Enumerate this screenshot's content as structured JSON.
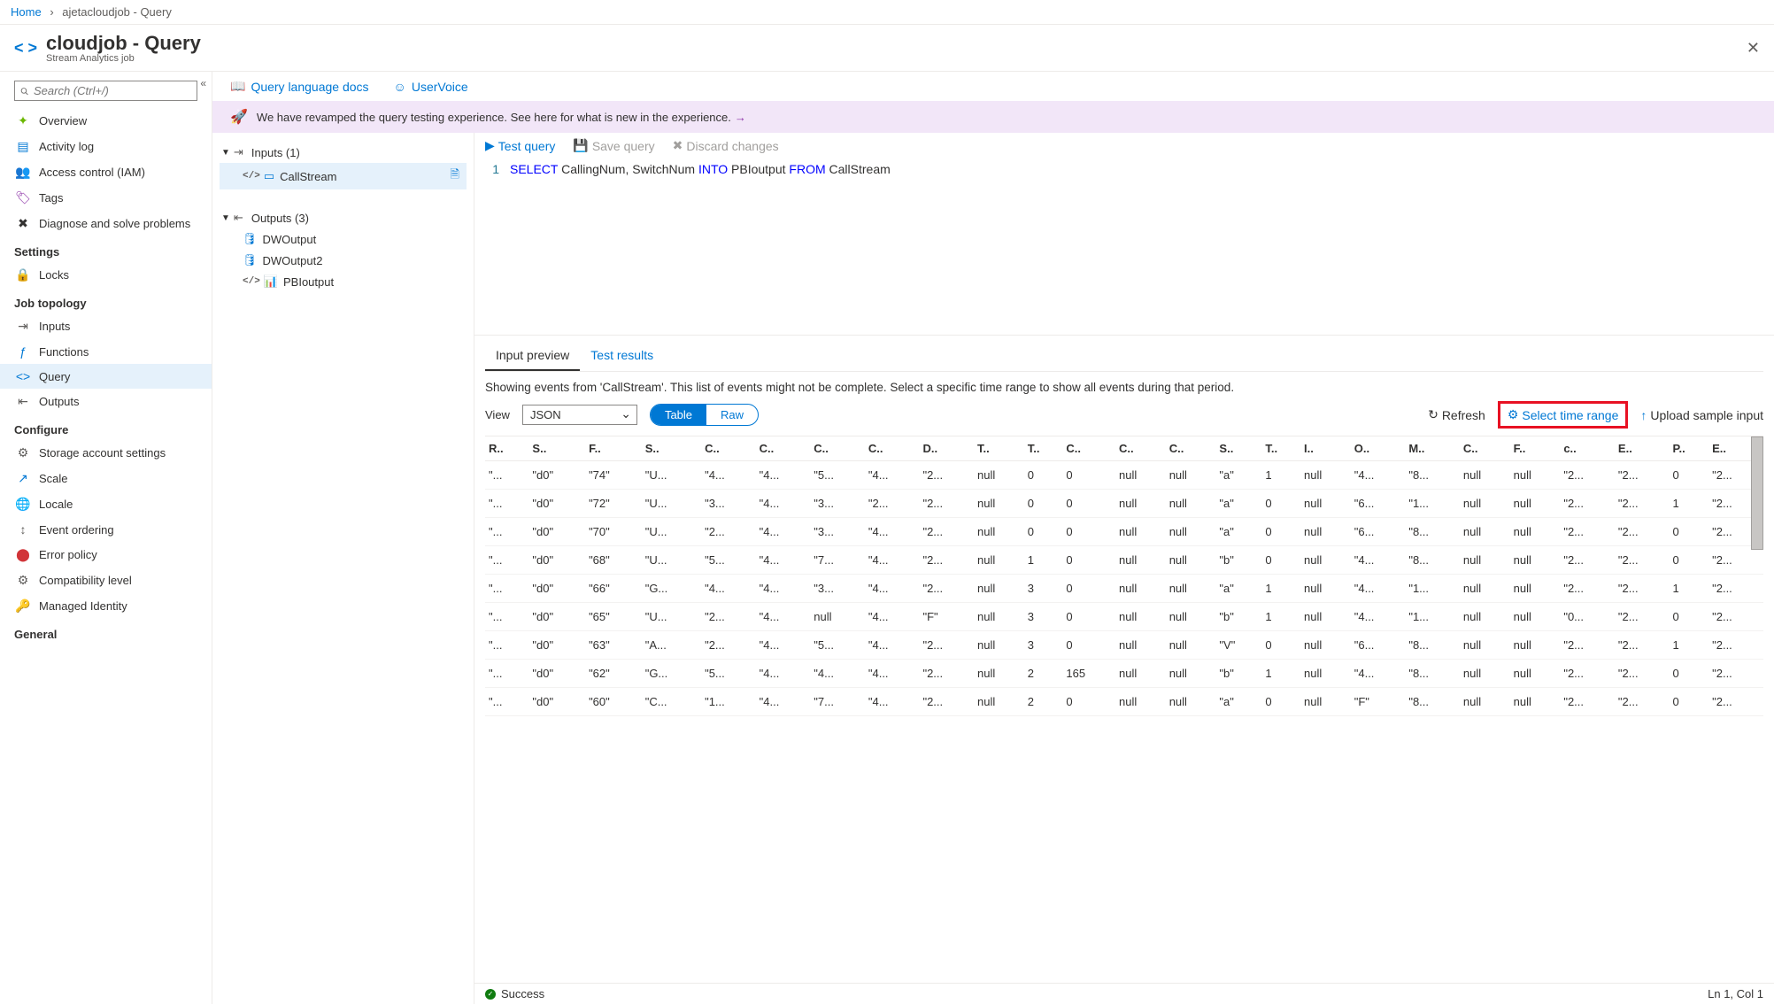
{
  "breadcrumb": {
    "home": "Home",
    "current": "ajetacloudjob - Query"
  },
  "header": {
    "title": "cloudjob - Query",
    "subtitle": "Stream Analytics job"
  },
  "sidebar": {
    "search_placeholder": "Search (Ctrl+/)",
    "groups": {
      "top": [
        {
          "label": "Overview"
        },
        {
          "label": "Activity log"
        },
        {
          "label": "Access control (IAM)"
        },
        {
          "label": "Tags"
        },
        {
          "label": "Diagnose and solve problems"
        }
      ],
      "settings_head": "Settings",
      "settings": [
        {
          "label": "Locks"
        }
      ],
      "topology_head": "Job topology",
      "topology": [
        {
          "label": "Inputs"
        },
        {
          "label": "Functions"
        },
        {
          "label": "Query"
        },
        {
          "label": "Outputs"
        }
      ],
      "configure_head": "Configure",
      "configure": [
        {
          "label": "Storage account settings"
        },
        {
          "label": "Scale"
        },
        {
          "label": "Locale"
        },
        {
          "label": "Event ordering"
        },
        {
          "label": "Error policy"
        },
        {
          "label": "Compatibility level"
        },
        {
          "label": "Managed Identity"
        }
      ],
      "general_head": "General"
    }
  },
  "toolbar": {
    "query_docs": "Query language docs",
    "uservoice": "UserVoice"
  },
  "banner": {
    "text": "We have revamped the query testing experience. See here for what is new in the experience."
  },
  "io": {
    "inputs_label": "Inputs (1)",
    "inputs": [
      {
        "label": "CallStream"
      }
    ],
    "outputs_label": "Outputs (3)",
    "outputs": [
      {
        "label": "DWOutput"
      },
      {
        "label": "DWOutput2"
      },
      {
        "label": "PBIoutput"
      }
    ]
  },
  "editor": {
    "test": "Test query",
    "save": "Save query",
    "discard": "Discard changes",
    "line_no": "1",
    "tokens": {
      "select": "SELECT",
      "cols": "CallingNum, SwitchNum",
      "into": "INTO",
      "target": "PBIoutput",
      "from": "FROM",
      "source": "CallStream"
    }
  },
  "results": {
    "tab_preview": "Input preview",
    "tab_results": "Test results",
    "description": "Showing events from 'CallStream'. This list of events might not be complete. Select a specific time range to show all events during that period.",
    "view_label": "View",
    "view_value": "JSON",
    "toggle_table": "Table",
    "toggle_raw": "Raw",
    "refresh": "Refresh",
    "select_time": "Select time range",
    "upload": "Upload sample input",
    "columns": [
      "R..",
      "S..",
      "F..",
      "S..",
      "C..",
      "C..",
      "C..",
      "C..",
      "D..",
      "T..",
      "T..",
      "C..",
      "C..",
      "C..",
      "S..",
      "T..",
      "I..",
      "O..",
      "M..",
      "C..",
      "F..",
      "c..",
      "E..",
      "P..",
      "E.."
    ],
    "rows": [
      [
        "\"...",
        "\"d0\"",
        "\"74\"",
        "\"U...",
        "\"4...",
        "\"4...",
        "\"5...",
        "\"4...",
        "\"2...",
        "null",
        "0",
        "0",
        "null",
        "null",
        "\"a\"",
        "1",
        "null",
        "\"4...",
        "\"8...",
        "null",
        "null",
        "\"2...",
        "\"2...",
        "0",
        "\"2..."
      ],
      [
        "\"...",
        "\"d0\"",
        "\"72\"",
        "\"U...",
        "\"3...",
        "\"4...",
        "\"3...",
        "\"2...",
        "\"2...",
        "null",
        "0",
        "0",
        "null",
        "null",
        "\"a\"",
        "0",
        "null",
        "\"6...",
        "\"1...",
        "null",
        "null",
        "\"2...",
        "\"2...",
        "1",
        "\"2..."
      ],
      [
        "\"...",
        "\"d0\"",
        "\"70\"",
        "\"U...",
        "\"2...",
        "\"4...",
        "\"3...",
        "\"4...",
        "\"2...",
        "null",
        "0",
        "0",
        "null",
        "null",
        "\"a\"",
        "0",
        "null",
        "\"6...",
        "\"8...",
        "null",
        "null",
        "\"2...",
        "\"2...",
        "0",
        "\"2..."
      ],
      [
        "\"...",
        "\"d0\"",
        "\"68\"",
        "\"U...",
        "\"5...",
        "\"4...",
        "\"7...",
        "\"4...",
        "\"2...",
        "null",
        "1",
        "0",
        "null",
        "null",
        "\"b\"",
        "0",
        "null",
        "\"4...",
        "\"8...",
        "null",
        "null",
        "\"2...",
        "\"2...",
        "0",
        "\"2..."
      ],
      [
        "\"...",
        "\"d0\"",
        "\"66\"",
        "\"G...",
        "\"4...",
        "\"4...",
        "\"3...",
        "\"4...",
        "\"2...",
        "null",
        "3",
        "0",
        "null",
        "null",
        "\"a\"",
        "1",
        "null",
        "\"4...",
        "\"1...",
        "null",
        "null",
        "\"2...",
        "\"2...",
        "1",
        "\"2..."
      ],
      [
        "\"...",
        "\"d0\"",
        "\"65\"",
        "\"U...",
        "\"2...",
        "\"4...",
        "null",
        "\"4...",
        "\"F\"",
        "null",
        "3",
        "0",
        "null",
        "null",
        "\"b\"",
        "1",
        "null",
        "\"4...",
        "\"1...",
        "null",
        "null",
        "\"0...",
        "\"2...",
        "0",
        "\"2..."
      ],
      [
        "\"...",
        "\"d0\"",
        "\"63\"",
        "\"A...",
        "\"2...",
        "\"4...",
        "\"5...",
        "\"4...",
        "\"2...",
        "null",
        "3",
        "0",
        "null",
        "null",
        "\"V\"",
        "0",
        "null",
        "\"6...",
        "\"8...",
        "null",
        "null",
        "\"2...",
        "\"2...",
        "1",
        "\"2..."
      ],
      [
        "\"...",
        "\"d0\"",
        "\"62\"",
        "\"G...",
        "\"5...",
        "\"4...",
        "\"4...",
        "\"4...",
        "\"2...",
        "null",
        "2",
        "165",
        "null",
        "null",
        "\"b\"",
        "1",
        "null",
        "\"4...",
        "\"8...",
        "null",
        "null",
        "\"2...",
        "\"2...",
        "0",
        "\"2..."
      ],
      [
        "\"...",
        "\"d0\"",
        "\"60\"",
        "\"C...",
        "\"1...",
        "\"4...",
        "\"7...",
        "\"4...",
        "\"2...",
        "null",
        "2",
        "0",
        "null",
        "null",
        "\"a\"",
        "0",
        "null",
        "\"F\"",
        "\"8...",
        "null",
        "null",
        "\"2...",
        "\"2...",
        "0",
        "\"2..."
      ]
    ]
  },
  "status": {
    "ok": "Success",
    "pos": "Ln 1, Col 1"
  }
}
